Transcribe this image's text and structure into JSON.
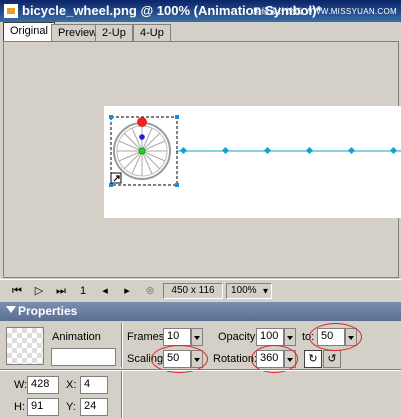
{
  "window": {
    "title": "bicycle_wheel.png @ 100% (Animation Symbol)*",
    "watermark": "思缘设计论坛 WWW.MISSYUAN.COM"
  },
  "tabs": [
    {
      "label": "Original",
      "active": true
    },
    {
      "label": "Preview",
      "active": false
    },
    {
      "label": "2-Up",
      "active": false
    },
    {
      "label": "4-Up",
      "active": false
    }
  ],
  "status": {
    "frame": "1",
    "canvas_size": "450 x 116",
    "zoom": "100%"
  },
  "properties": {
    "title": "Properties",
    "symbol_type": "Animation",
    "name_value": "",
    "frames_label": "Frames:",
    "frames_value": "10",
    "opacity_label": "Opacity:",
    "opacity_from": "100",
    "to_label": "to:",
    "opacity_to": "50",
    "scaling_label": "Scaling:",
    "scaling_value": "50",
    "rotation_label": "Rotation:",
    "rotation_value": "360",
    "w_label": "W:",
    "w_value": "428",
    "x_label": "X:",
    "x_value": "4",
    "h_label": "H:",
    "h_value": "91",
    "y_label": "Y:",
    "y_value": "24",
    "rotation_direction": "clockwise"
  },
  "colors": {
    "highlight_ellipse": "#e02020",
    "motion_path": "#1aa0c8",
    "selection_handle": "#1a8cd8"
  }
}
